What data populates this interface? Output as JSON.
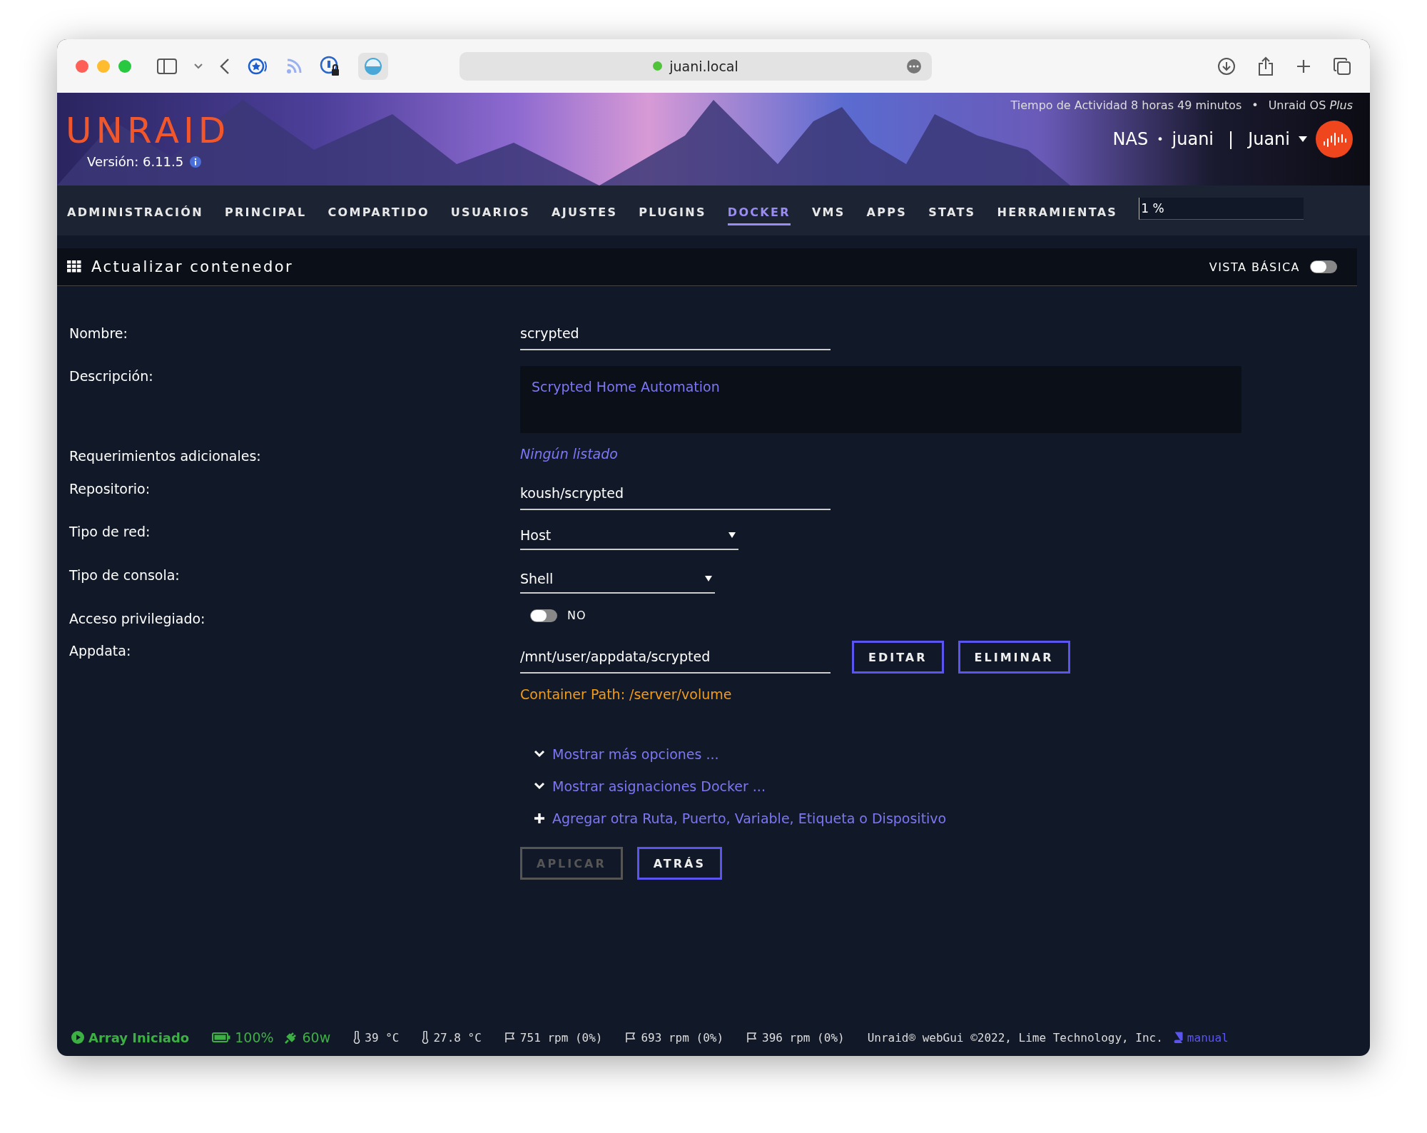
{
  "browser": {
    "address": "juani.local"
  },
  "header": {
    "logo": "UNRAID",
    "version": "Versión: 6.11.5",
    "uptime": "Tiempo de Actividad 8 horas 49 minutos",
    "separator": "•",
    "os": "Unraid OS *Plus*",
    "server": "NAS",
    "server_separator": "•",
    "host": "juani",
    "divider": "|",
    "user": "Juani"
  },
  "nav": {
    "items": [
      {
        "label": "ADMINISTRACIÓN",
        "selected": false
      },
      {
        "label": "PRINCIPAL",
        "selected": false
      },
      {
        "label": "COMPARTIDO",
        "selected": false
      },
      {
        "label": "USUARIOS",
        "selected": false
      },
      {
        "label": "AJUSTES",
        "selected": false
      },
      {
        "label": "PLUGINS",
        "selected": false
      },
      {
        "label": "DOCKER",
        "selected": true
      },
      {
        "label": "VMS",
        "selected": false
      },
      {
        "label": "APPS",
        "selected": false
      },
      {
        "label": "STATS",
        "selected": false
      },
      {
        "label": "HERRAMIENTAS",
        "selected": false
      }
    ],
    "search": {
      "value": "1 %"
    }
  },
  "section": {
    "title": "Actualizar contenedor",
    "basic_view": {
      "label": "VISTA BÁSICA",
      "on": false
    }
  },
  "form": {
    "rows": [
      {
        "kind": "input",
        "label": "Nombre:",
        "value": "scrypted"
      },
      {
        "kind": "textarea",
        "label": "Descripción:",
        "value": "Scrypted Home Automation"
      },
      {
        "kind": "note",
        "label": "Requerimientos adicionales:",
        "value": "Ningún listado"
      },
      {
        "kind": "input",
        "label": "Repositorio:",
        "value": "koush/scrypted"
      },
      {
        "kind": "select",
        "label": "Tipo de red:",
        "value": "Host",
        "wide": true
      },
      {
        "kind": "select",
        "label": "Tipo de consola:",
        "value": "Shell",
        "wide": false
      },
      {
        "kind": "toggle",
        "label": "Acceso privilegiado:",
        "on": false,
        "value": "NO"
      },
      {
        "kind": "path",
        "label": "Appdata:",
        "value": "/mnt/user/appdata/scrypted",
        "buttons": [
          "EDITAR",
          "ELIMINAR"
        ],
        "hint": "Container Path: /server/volume"
      }
    ],
    "links": [
      {
        "kind": "expand",
        "label": "Mostrar más opciones ..."
      },
      {
        "kind": "expand",
        "label": "Mostrar asignaciones Docker ..."
      },
      {
        "kind": "add",
        "label": "Agregar otra Ruta, Puerto, Variable, Etiqueta o Dispositivo"
      }
    ],
    "buttons": [
      {
        "label": "APLICAR",
        "disabled": true
      },
      {
        "label": "ATRÁS",
        "disabled": false
      }
    ]
  },
  "status_bar": {
    "array": "Array Iniciado",
    "battery": "100%",
    "power": "60w",
    "temps": [
      "39 °C",
      "27.8 °C"
    ],
    "fans": [
      "751 rpm (0%)",
      "693 rpm (0%)",
      "396 rpm (0%)"
    ],
    "copyright": "Unraid® webGui ©2022, Lime Technology, Inc.",
    "manual": "manual"
  }
}
